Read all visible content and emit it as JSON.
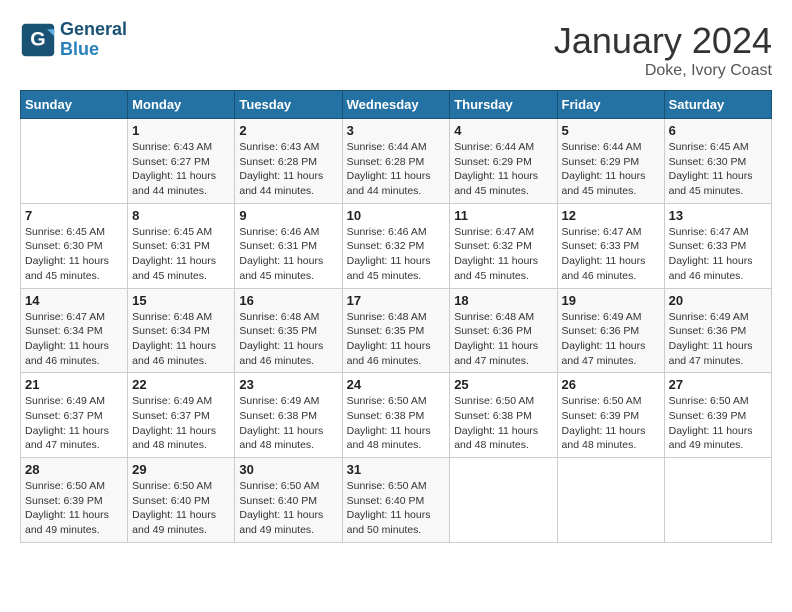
{
  "header": {
    "logo_line1": "General",
    "logo_line2": "Blue",
    "month": "January 2024",
    "location": "Doke, Ivory Coast"
  },
  "days_of_week": [
    "Sunday",
    "Monday",
    "Tuesday",
    "Wednesday",
    "Thursday",
    "Friday",
    "Saturday"
  ],
  "weeks": [
    [
      {
        "day": "",
        "info": ""
      },
      {
        "day": "1",
        "info": "Sunrise: 6:43 AM\nSunset: 6:27 PM\nDaylight: 11 hours\nand 44 minutes."
      },
      {
        "day": "2",
        "info": "Sunrise: 6:43 AM\nSunset: 6:28 PM\nDaylight: 11 hours\nand 44 minutes."
      },
      {
        "day": "3",
        "info": "Sunrise: 6:44 AM\nSunset: 6:28 PM\nDaylight: 11 hours\nand 44 minutes."
      },
      {
        "day": "4",
        "info": "Sunrise: 6:44 AM\nSunset: 6:29 PM\nDaylight: 11 hours\nand 45 minutes."
      },
      {
        "day": "5",
        "info": "Sunrise: 6:44 AM\nSunset: 6:29 PM\nDaylight: 11 hours\nand 45 minutes."
      },
      {
        "day": "6",
        "info": "Sunrise: 6:45 AM\nSunset: 6:30 PM\nDaylight: 11 hours\nand 45 minutes."
      }
    ],
    [
      {
        "day": "7",
        "info": "Sunrise: 6:45 AM\nSunset: 6:30 PM\nDaylight: 11 hours\nand 45 minutes."
      },
      {
        "day": "8",
        "info": "Sunrise: 6:45 AM\nSunset: 6:31 PM\nDaylight: 11 hours\nand 45 minutes."
      },
      {
        "day": "9",
        "info": "Sunrise: 6:46 AM\nSunset: 6:31 PM\nDaylight: 11 hours\nand 45 minutes."
      },
      {
        "day": "10",
        "info": "Sunrise: 6:46 AM\nSunset: 6:32 PM\nDaylight: 11 hours\nand 45 minutes."
      },
      {
        "day": "11",
        "info": "Sunrise: 6:47 AM\nSunset: 6:32 PM\nDaylight: 11 hours\nand 45 minutes."
      },
      {
        "day": "12",
        "info": "Sunrise: 6:47 AM\nSunset: 6:33 PM\nDaylight: 11 hours\nand 46 minutes."
      },
      {
        "day": "13",
        "info": "Sunrise: 6:47 AM\nSunset: 6:33 PM\nDaylight: 11 hours\nand 46 minutes."
      }
    ],
    [
      {
        "day": "14",
        "info": "Sunrise: 6:47 AM\nSunset: 6:34 PM\nDaylight: 11 hours\nand 46 minutes."
      },
      {
        "day": "15",
        "info": "Sunrise: 6:48 AM\nSunset: 6:34 PM\nDaylight: 11 hours\nand 46 minutes."
      },
      {
        "day": "16",
        "info": "Sunrise: 6:48 AM\nSunset: 6:35 PM\nDaylight: 11 hours\nand 46 minutes."
      },
      {
        "day": "17",
        "info": "Sunrise: 6:48 AM\nSunset: 6:35 PM\nDaylight: 11 hours\nand 46 minutes."
      },
      {
        "day": "18",
        "info": "Sunrise: 6:48 AM\nSunset: 6:36 PM\nDaylight: 11 hours\nand 47 minutes."
      },
      {
        "day": "19",
        "info": "Sunrise: 6:49 AM\nSunset: 6:36 PM\nDaylight: 11 hours\nand 47 minutes."
      },
      {
        "day": "20",
        "info": "Sunrise: 6:49 AM\nSunset: 6:36 PM\nDaylight: 11 hours\nand 47 minutes."
      }
    ],
    [
      {
        "day": "21",
        "info": "Sunrise: 6:49 AM\nSunset: 6:37 PM\nDaylight: 11 hours\nand 47 minutes."
      },
      {
        "day": "22",
        "info": "Sunrise: 6:49 AM\nSunset: 6:37 PM\nDaylight: 11 hours\nand 48 minutes."
      },
      {
        "day": "23",
        "info": "Sunrise: 6:49 AM\nSunset: 6:38 PM\nDaylight: 11 hours\nand 48 minutes."
      },
      {
        "day": "24",
        "info": "Sunrise: 6:50 AM\nSunset: 6:38 PM\nDaylight: 11 hours\nand 48 minutes."
      },
      {
        "day": "25",
        "info": "Sunrise: 6:50 AM\nSunset: 6:38 PM\nDaylight: 11 hours\nand 48 minutes."
      },
      {
        "day": "26",
        "info": "Sunrise: 6:50 AM\nSunset: 6:39 PM\nDaylight: 11 hours\nand 48 minutes."
      },
      {
        "day": "27",
        "info": "Sunrise: 6:50 AM\nSunset: 6:39 PM\nDaylight: 11 hours\nand 49 minutes."
      }
    ],
    [
      {
        "day": "28",
        "info": "Sunrise: 6:50 AM\nSunset: 6:39 PM\nDaylight: 11 hours\nand 49 minutes."
      },
      {
        "day": "29",
        "info": "Sunrise: 6:50 AM\nSunset: 6:40 PM\nDaylight: 11 hours\nand 49 minutes."
      },
      {
        "day": "30",
        "info": "Sunrise: 6:50 AM\nSunset: 6:40 PM\nDaylight: 11 hours\nand 49 minutes."
      },
      {
        "day": "31",
        "info": "Sunrise: 6:50 AM\nSunset: 6:40 PM\nDaylight: 11 hours\nand 50 minutes."
      },
      {
        "day": "",
        "info": ""
      },
      {
        "day": "",
        "info": ""
      },
      {
        "day": "",
        "info": ""
      }
    ]
  ]
}
